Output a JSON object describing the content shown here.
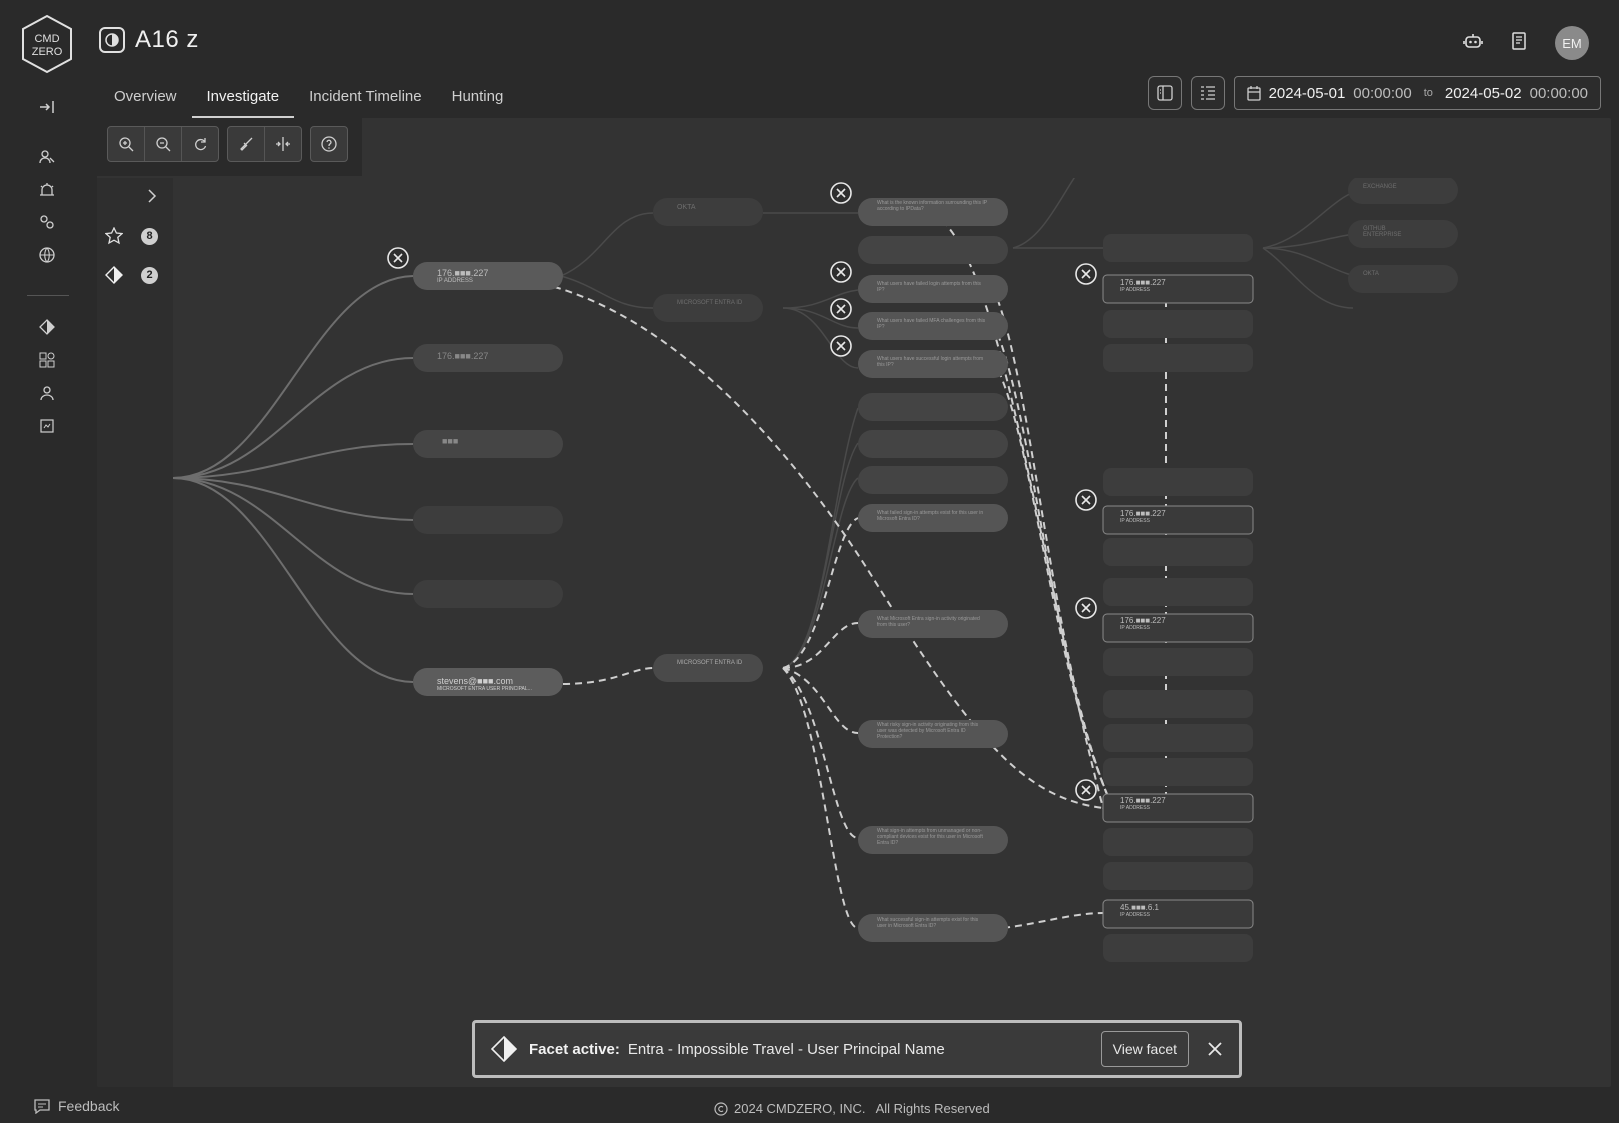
{
  "app": {
    "logo_text": "CMD ZERO",
    "incident_title": "A16 z",
    "avatar_initials": "EM"
  },
  "tabs": [
    {
      "label": "Overview",
      "active": false
    },
    {
      "label": "Investigate",
      "active": true
    },
    {
      "label": "Incident Timeline",
      "active": false
    },
    {
      "label": "Hunting",
      "active": false
    }
  ],
  "date_range": {
    "start_date": "2024-05-01",
    "start_time": "00:00:00",
    "to_label": "to",
    "end_date": "2024-05-02",
    "end_time": "00:00:00"
  },
  "left_panel": {
    "starred_count": "8",
    "facet_count": "2"
  },
  "graph": {
    "root_nodes": [
      {
        "text": "176.■■■.227",
        "sub": "IP ADDRESS"
      },
      {
        "text": "176.■■■.227",
        "sub": ""
      },
      {
        "text": "■■■",
        "sub": ""
      },
      {
        "text": "stevens@■■■.com",
        "sub": "MICROSOFT ENTRA USER PRINCIPAL..."
      }
    ],
    "mid_nodes": [
      {
        "text": "OKTA"
      },
      {
        "text": "MICROSOFT ENTRA ID"
      },
      {
        "text": "MICROSOFT ENTRA ID"
      }
    ],
    "questions": [
      "What is the known information surrounding this IP according to IPData?",
      "What users have failed login attempts from this IP?",
      "What users have failed MFA challenges from this IP?",
      "What users have successful login attempts from this IP?",
      "What failed sign-in attempts exist for this user in Microsoft Entra ID?",
      "What Microsoft Entra sign-in activity originated from this user?",
      "What risky sign-in activity originating from this user was detected by Microsoft Entra ID Protection?",
      "What sign-in attempts from unmanaged or non-compliant devices exist for this user in Microsoft Entra ID?",
      "What successful sign-in attempts exist for this user in Microsoft Entra ID?"
    ],
    "result_nodes": [
      {
        "text": "176.■■■.227",
        "sub": "IP ADDRESS"
      },
      {
        "text": "176.■■■.227",
        "sub": "IP ADDRESS"
      },
      {
        "text": "176.■■■.227",
        "sub": "IP ADDRESS"
      },
      {
        "text": "176.■■■.227",
        "sub": "IP ADDRESS"
      },
      {
        "text": "45.■■■.6.1",
        "sub": "IP ADDRESS"
      }
    ],
    "far_nodes": [
      {
        "text": "EXCHANGE"
      },
      {
        "text": "GITHUB ENTERPRISE"
      },
      {
        "text": "OKTA"
      }
    ]
  },
  "facet_bar": {
    "label": "Facet active:",
    "value": "Entra - Impossible Travel - User Principal Name",
    "button": "View facet"
  },
  "footer": {
    "feedback": "Feedback",
    "copyright": "2024 CMDZERO, INC.   All Rights Reserved"
  }
}
